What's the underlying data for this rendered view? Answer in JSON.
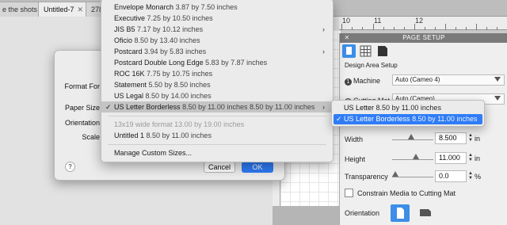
{
  "tabs": [
    {
      "label": "e the shots",
      "active": false
    },
    {
      "label": "Untitled-7",
      "active": true
    },
    {
      "label": "278",
      "active": false
    }
  ],
  "ruler": {
    "numbers": [
      "10",
      "11",
      "12"
    ]
  },
  "page_setup": {
    "title": "PAGE SETUP",
    "section_label": "Design Area Setup",
    "machine": {
      "label": "Machine",
      "step": "1",
      "value": "Auto (Cameo 4)"
    },
    "cutting_mat": {
      "label": "Cutting Mat",
      "step": "2",
      "value": "Auto (Cameo)"
    },
    "width": {
      "label": "Width",
      "value": "8.500",
      "unit": "in",
      "slider_fraction": 0.45
    },
    "height": {
      "label": "Height",
      "value": "11.000",
      "unit": "in",
      "slider_fraction": 0.6
    },
    "transparency": {
      "label": "Transparency",
      "value": "0.0",
      "unit": "%",
      "slider_fraction": 0.0
    },
    "constrain_label": "Constrain Media to Cutting Mat",
    "orientation_label": "Orientation"
  },
  "dialog": {
    "format_for_label": "Format For",
    "paper_size_label": "Paper Size",
    "orientation_label": "Orientation",
    "scale_label": "Scale",
    "help_label": "?",
    "cancel_label": "Cancel",
    "ok_label": "OK"
  },
  "menu": {
    "items": [
      {
        "name": "Envelope Monarch",
        "size": "3.87 by 7.50 inches",
        "submenu": false,
        "checked": false,
        "disabled": false
      },
      {
        "name": "Executive",
        "size": "7.25 by 10.50 inches",
        "submenu": false,
        "checked": false,
        "disabled": false
      },
      {
        "name": "JIS B5",
        "size": "7.17 by 10.12 inches",
        "submenu": true,
        "checked": false,
        "disabled": false
      },
      {
        "name": "Oficio",
        "size": "8.50 by 13.40 inches",
        "submenu": false,
        "checked": false,
        "disabled": false
      },
      {
        "name": "Postcard",
        "size": "3.94 by 5.83 inches",
        "submenu": true,
        "checked": false,
        "disabled": false
      },
      {
        "name": "Postcard Double Long Edge",
        "size": "5.83 by 7.87 inches",
        "submenu": false,
        "checked": false,
        "disabled": false
      },
      {
        "name": "ROC 16K",
        "size": "7.75 by 10.75 inches",
        "submenu": false,
        "checked": false,
        "disabled": false
      },
      {
        "name": "Statement",
        "size": "5.50 by 8.50 inches",
        "submenu": false,
        "checked": false,
        "disabled": false
      },
      {
        "name": "US Legal",
        "size": "8.50 by 14.00 inches",
        "submenu": false,
        "checked": false,
        "disabled": false
      },
      {
        "name": "US Letter Borderless",
        "size": "8.50 by 11.00 inches 8.50 by 11.00 inches",
        "submenu": true,
        "checked": true,
        "disabled": false
      }
    ],
    "custom_items": [
      {
        "name": "13x19 wide format",
        "size": "13.00 by 19.00 inches",
        "disabled": true
      },
      {
        "name": "Untitled 1",
        "size": "8.50 by 11.00 inches",
        "disabled": false
      }
    ],
    "manage_label": "Manage Custom Sizes...",
    "check_glyph": "✓",
    "arrow_glyph": "›"
  },
  "submenu": {
    "items": [
      {
        "name": "US Letter",
        "size": "8.50 by 11.00 inches",
        "checked": false,
        "highlighted": false
      },
      {
        "name": "US Letter Borderless",
        "size": "8.50 by 11.00 inches",
        "checked": true,
        "highlighted": true
      }
    ]
  },
  "colors": {
    "accent": "#2f7cf6",
    "panel_header": "#7a7a7a",
    "menu_bg": "#ebebeb"
  }
}
